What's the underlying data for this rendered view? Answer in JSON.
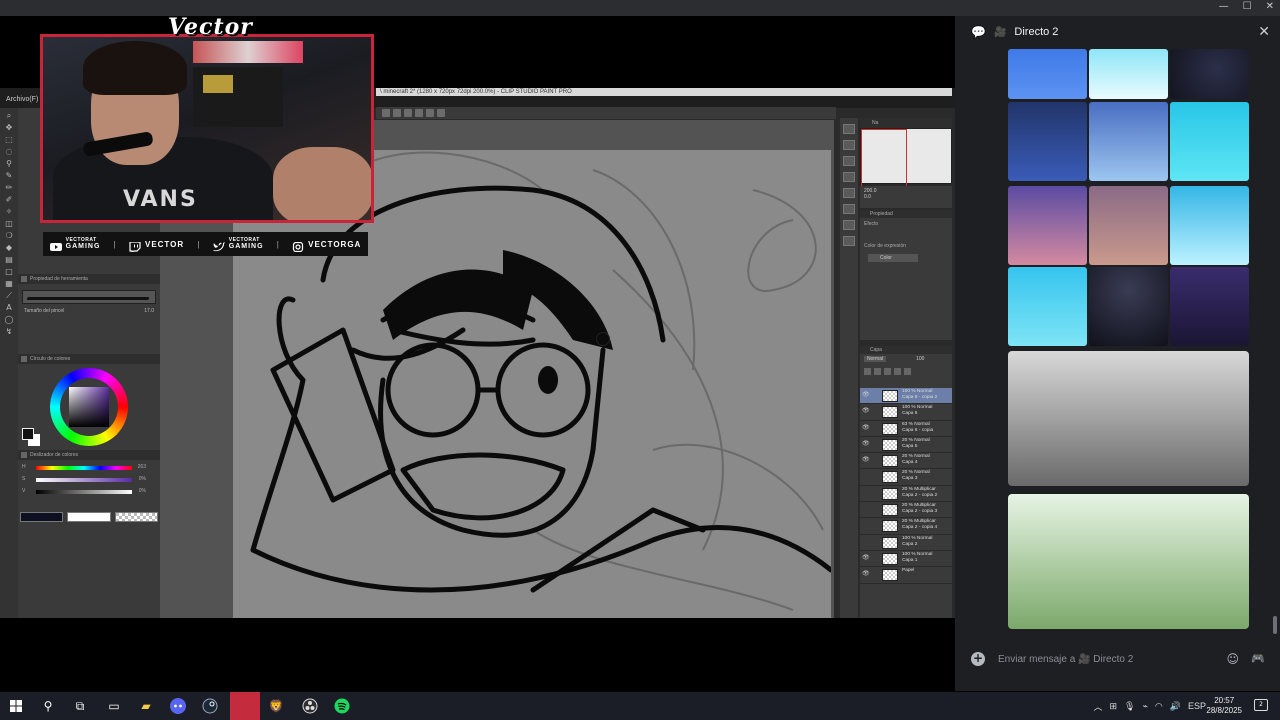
{
  "window": {
    "controls": [
      "—",
      "☐",
      "✕"
    ]
  },
  "overlay": {
    "brand_logo": "Vector",
    "shirt_text": "VANS",
    "socials": [
      {
        "icon": "youtube-icon",
        "line1": "VECTORAT",
        "line2": "GAMING"
      },
      {
        "icon": "twitch-icon",
        "text": "VECTOR"
      },
      {
        "icon": "twitter-icon",
        "line1": "VECTORAT",
        "line2": "GAMING"
      },
      {
        "icon": "instagram-icon",
        "text": "VECTORGA"
      }
    ],
    "separator": "|"
  },
  "csp": {
    "file_menu": "Archivo(F)",
    "title": "\\ minecraft 2* (1280 x 720px 72dpi 200.0%) - CLIP STUDIO PAINT PRO",
    "tool_property_title": "Propiedad de herramienta",
    "brush_size_label": "Tamaño del pincel",
    "brush_size_value": "17.0",
    "color_wheel_title": "Círculo de colores",
    "color_slider_title": "Deslizador de colores",
    "sliders": [
      {
        "label": "H",
        "value": "263",
        "gradient": "linear-gradient(to right,#f00,#ff0,#0f0,#0ff,#00f,#f0f,#f00)"
      },
      {
        "label": "S",
        "value": "0%",
        "gradient": "linear-gradient(to right,#fff,#5a2ca0)"
      },
      {
        "label": "V",
        "value": "0%",
        "gradient": "linear-gradient(to right,#000,#fff)"
      }
    ],
    "navigator_label": "Na",
    "zoom": "200.0",
    "rotation": "0.0",
    "properties_title": "Propiedad",
    "effect_label": "Efecto",
    "expression_color_label": "Color de expresión",
    "expression_color_value": "Color",
    "layer_title": "Capa",
    "blend_mode": "Normal",
    "opacity": "100",
    "layers": [
      {
        "name": "100 % Normal\nCapa 6 - copia 2",
        "selected": true,
        "visible": true
      },
      {
        "name": "100 % Normal\nCapa 6",
        "selected": false,
        "visible": true
      },
      {
        "name": "63 % Normal\nCapa 6 - copia",
        "selected": false,
        "visible": true
      },
      {
        "name": "20 % Normal\nCapa 5",
        "selected": false,
        "visible": true
      },
      {
        "name": "20 % Normal\nCapa 4",
        "selected": false,
        "visible": true
      },
      {
        "name": "20 % Normal\nCapa 3",
        "selected": false,
        "visible": false
      },
      {
        "name": "20 % Multiplicar\nCapa 2 - copia 2",
        "selected": false,
        "visible": false
      },
      {
        "name": "20 % Multiplicar\nCapa 2 - copia 3",
        "selected": false,
        "visible": false
      },
      {
        "name": "20 % Multiplicar\nCapa 2 - copia 4",
        "selected": false,
        "visible": false
      },
      {
        "name": "100 % Normal\nCapa 2",
        "selected": false,
        "visible": false
      },
      {
        "name": "100 % Normal\nCapa 1",
        "selected": false,
        "visible": true
      },
      {
        "name": "Papel",
        "selected": false,
        "visible": true
      }
    ]
  },
  "discord": {
    "channel": "Directo 2",
    "message_placeholder": "Enviar mensaje a  🎥 Directo 2",
    "tiles": [
      {
        "bg": "linear-gradient(#3f7ae8,#5c92f2)"
      },
      {
        "bg": "linear-gradient(#8fe6f7,#e9fbff)"
      },
      {
        "bg": "radial-gradient(circle at 60% 40%,#2b2f4a,#14151f)"
      },
      {
        "bg": "linear-gradient(#22356b,#3a5cb8)"
      },
      {
        "bg": "linear-gradient(#4a6ec2,#9cc6ef)"
      },
      {
        "bg": "linear-gradient(#28c6e6,#5ee6f5)"
      },
      {
        "bg": "linear-gradient(#5a4ba3,#d48aa0)"
      },
      {
        "bg": "linear-gradient(#8a6a86,#c99a8c)"
      },
      {
        "bg": "linear-gradient(#34b6e6,#bdf2ff)"
      },
      {
        "bg": "linear-gradient(#35c4ee,#7ee4f6)"
      },
      {
        "bg": "radial-gradient(circle at 50% 30%,#3a3c55,#10111a)"
      },
      {
        "bg": "linear-gradient(#3a2c6e,#1b1633)"
      }
    ],
    "big_images": [
      {
        "bg": "linear-gradient(#d8d8d8,#6a6a6a)"
      },
      {
        "bg": "linear-gradient(#e6f4e4,#7ca86a)"
      }
    ]
  },
  "taskbar": {
    "language": "ESP",
    "time": "20:57",
    "date": "28/8/2025",
    "notification_count": "2"
  }
}
